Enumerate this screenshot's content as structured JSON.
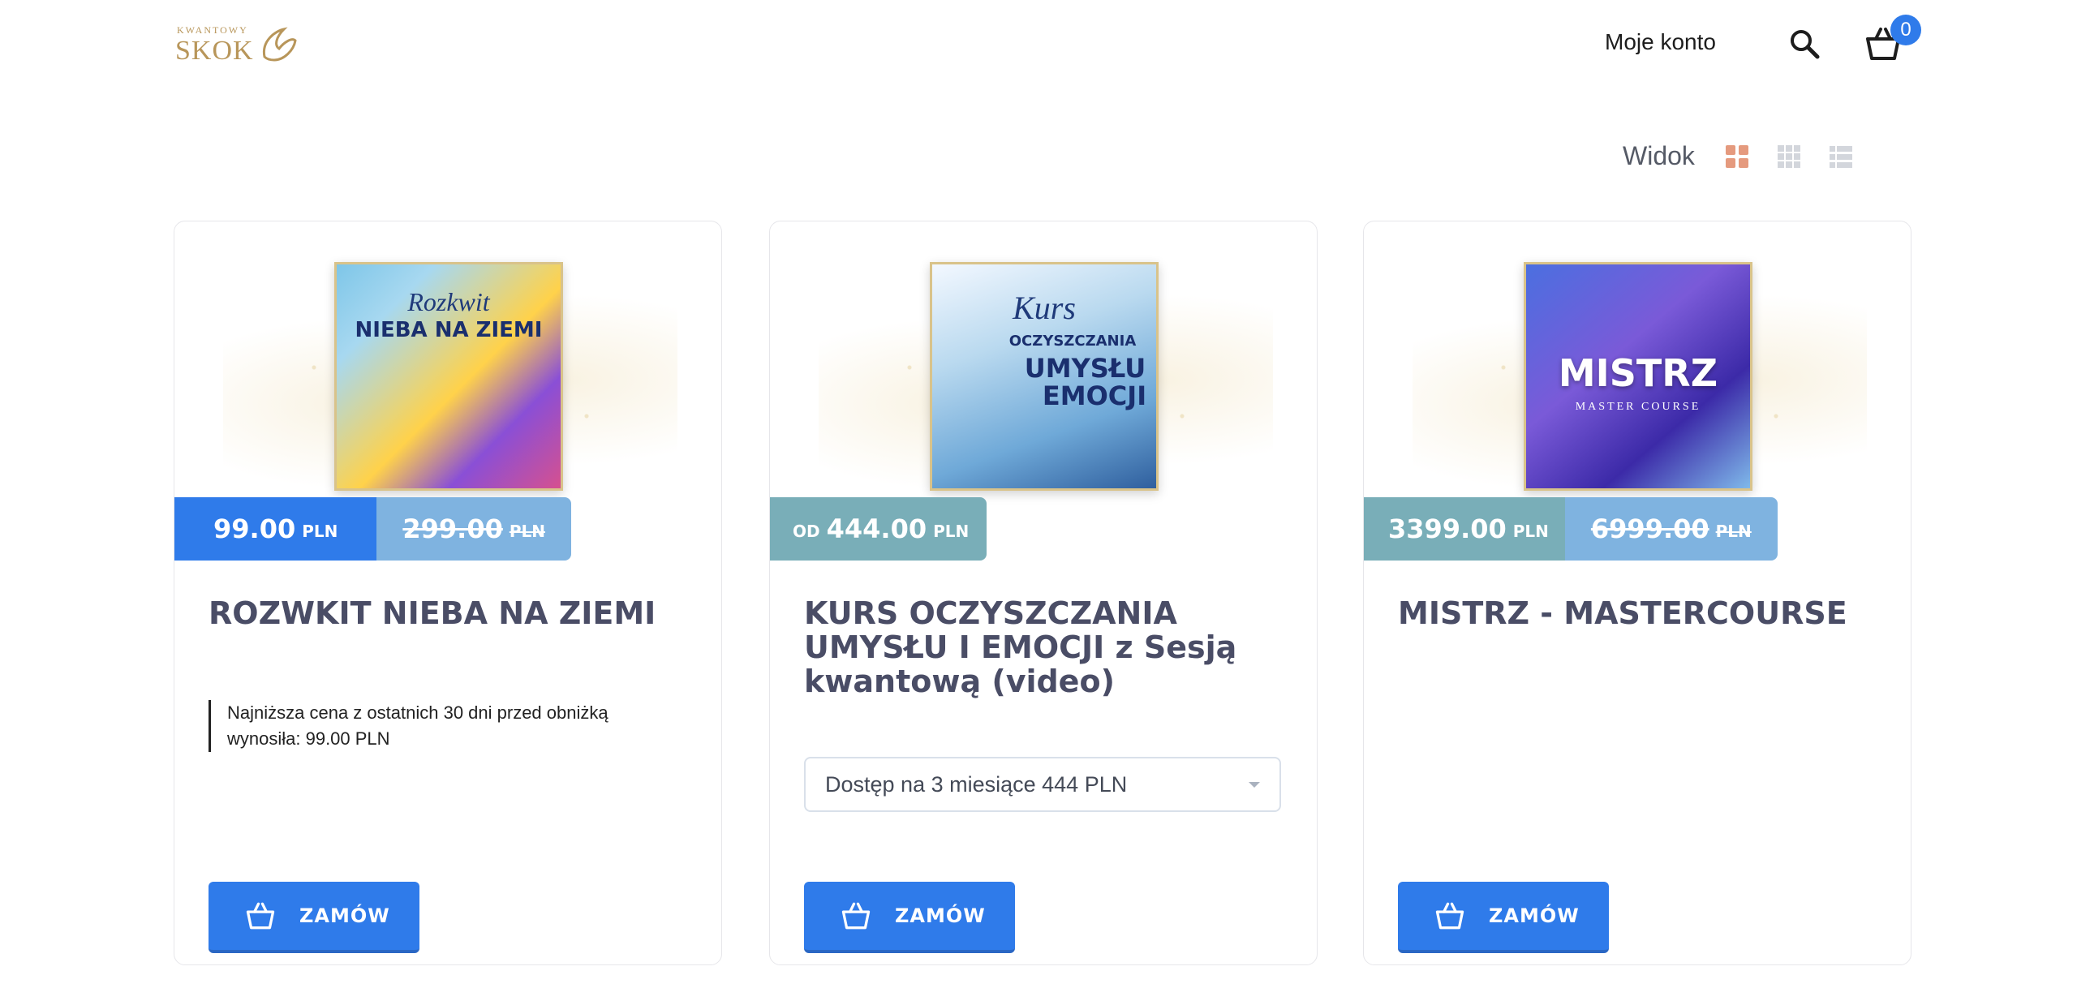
{
  "header": {
    "logo_small": "KWANTOWY",
    "logo_big": "SKOK",
    "account_label": "Moje konto",
    "cart_count": "0",
    "icons": {
      "search": "search-icon",
      "cart": "basket-icon"
    }
  },
  "view": {
    "label": "Widok",
    "modes": [
      "grid-large",
      "grid-small",
      "list"
    ],
    "active": "grid-large",
    "active_color": "#e59a7e",
    "inactive_color": "#d3d6dc"
  },
  "colors": {
    "accent": "#2f7bea",
    "teal": "#79aeb8",
    "old_price": "#7fb3e0",
    "title": "#4a4d66"
  },
  "products": [
    {
      "image": {
        "script": "Rozkwit",
        "bold": "NIEBA NA ZIEMI"
      },
      "price_new": "99.00",
      "currency": "PLN",
      "price_old": "299.00",
      "title": "ROZWKIT NIEBA NA ZIEMI",
      "note": "Najniższa cena z ostatnich 30 dni przed obniżką wynosiła: 99.00 PLN",
      "button": "ZAMÓW"
    },
    {
      "image": {
        "script": "Kurs",
        "bold_small": "OCZYSZCZANIA",
        "bold": "UMYSŁU I EMOCJI"
      },
      "price_prefix": "OD",
      "price_new": "444.00",
      "currency": "PLN",
      "title": "KURS OCZYSZCZANIA UMYSŁU I EMOCJI z Sesją kwantową (video)",
      "variant": "Dostęp na 3 miesiące 444 PLN",
      "button": "ZAMÓW"
    },
    {
      "image": {
        "bold": "MISTRZ",
        "sub": "MASTER COURSE"
      },
      "price_new": "3399.00",
      "currency": "PLN",
      "price_old": "6999.00",
      "title": "MISTRZ - MASTERCOURSE",
      "button": "ZAMÓW"
    }
  ]
}
